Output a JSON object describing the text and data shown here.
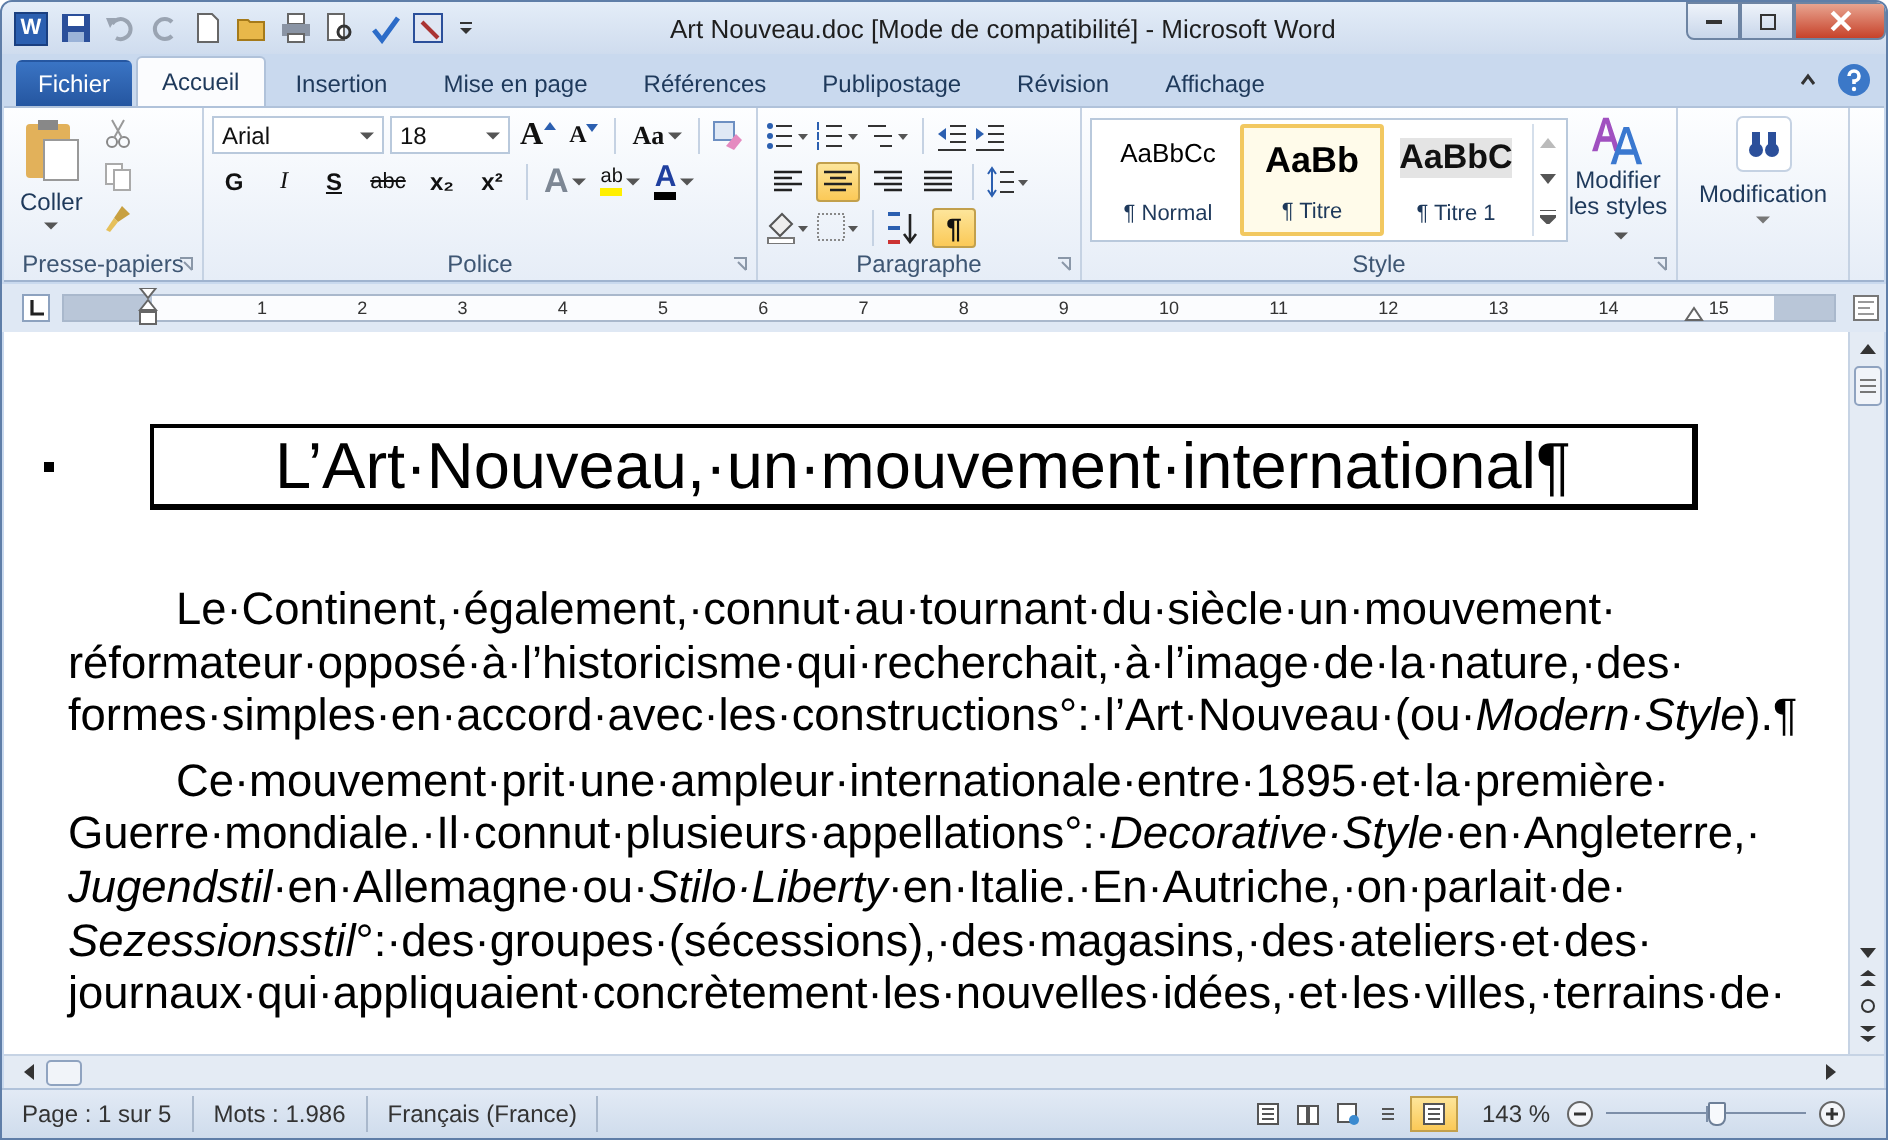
{
  "window": {
    "title": "Art Nouveau.doc [Mode de compatibilité]  -  Microsoft Word",
    "app_logo": "W"
  },
  "tabs": [
    {
      "label": "Fichier",
      "kind": "file",
      "selected": false
    },
    {
      "label": "Accueil",
      "kind": "tab",
      "selected": true
    },
    {
      "label": "Insertion",
      "kind": "tab",
      "selected": false
    },
    {
      "label": "Mise en page",
      "kind": "tab",
      "selected": false
    },
    {
      "label": "Références",
      "kind": "tab",
      "selected": false
    },
    {
      "label": "Publipostage",
      "kind": "tab",
      "selected": false
    },
    {
      "label": "Révision",
      "kind": "tab",
      "selected": false
    },
    {
      "label": "Affichage",
      "kind": "tab",
      "selected": false
    }
  ],
  "clipboard": {
    "paste_label": "Coller",
    "group_label": "Presse-papiers"
  },
  "font": {
    "name": "Arial",
    "size": "18",
    "grow": "A",
    "shrink": "A",
    "change_case": "Aa",
    "group_label": "Police",
    "format_buttons": [
      {
        "kind": "bold",
        "label": "G"
      },
      {
        "kind": "italic",
        "label": "I"
      },
      {
        "kind": "underline",
        "label": "S"
      },
      {
        "kind": "strike",
        "label": "abc"
      },
      {
        "kind": "sub",
        "label": "x₂"
      },
      {
        "kind": "sup",
        "label": "x²"
      }
    ],
    "effects": "A",
    "highlight": "ab",
    "font_color_label": "A"
  },
  "paragraph": {
    "group_label": "Paragraphe",
    "show_marks": {
      "label": "¶",
      "selected": true
    },
    "align_buttons": [
      {
        "kind": "left",
        "selected": false
      },
      {
        "kind": "center",
        "selected": true
      },
      {
        "kind": "right",
        "selected": false
      },
      {
        "kind": "justify",
        "selected": false
      }
    ]
  },
  "styles": {
    "group_label": "Style",
    "modify_label": "Modifier les styles",
    "items": [
      {
        "preview": "AaBbCc",
        "name": "¶ Normal",
        "kind": "normal",
        "selected": false
      },
      {
        "preview": "AaBb",
        "name": "¶ Titre",
        "kind": "title",
        "selected": true
      },
      {
        "preview": "AaBbC",
        "name": "¶ Titre 1",
        "kind": "heading",
        "selected": false
      }
    ]
  },
  "editing": {
    "label": "Modification"
  },
  "ruler": {
    "numbers": [
      "1",
      "2",
      "3",
      "4",
      "5",
      "6",
      "7",
      "8",
      "9",
      "10",
      "11",
      "12",
      "13",
      "14",
      "15"
    ]
  },
  "document": {
    "title": "L’Art·Nouveau,·un·mouvement·international¶",
    "paragraphs": [
      {
        "lines": [
          "Le·Continent,·également,·connut·au·tournant·du·siècle·un·mouvement·",
          "réformateur·opposé·à·l’historicisme·qui·recherchait,·à·l’image·de·la·nature,·des·",
          "formes·simples·en·accord·avec·les·constructions°:·l’Art·Nouveau·(ou·*Modern·Style*).¶"
        ]
      },
      {
        "lines": [
          "Ce·mouvement·prit·une·ampleur·internationale·entre·1895·et·la·première·",
          "Guerre·mondiale.·Il·connut·plusieurs·appellations°:·*Decorative·Style*·en·Angleterre,·",
          "*Jugendstil*·en·Allemagne·ou·*Stilo·Liberty*·en·Italie.·En·Autriche,·on·parlait·de·",
          "*Sezessionsstil*°:·des·groupes·(sécessions),·des·magasins,·des·ateliers·et·des·",
          "journaux·qui·appliquaient·concrètement·les·nouvelles·idées,·et·les·villes,·terrains·de·"
        ]
      }
    ]
  },
  "status_bar": {
    "page": "Page : 1 sur 5",
    "words": "Mots : 1.986",
    "language": "Français (France)",
    "zoom": "143 %",
    "zoom_level": {
      "level": 0.55
    },
    "views": [
      {
        "kind": "print",
        "selected": false
      },
      {
        "kind": "read",
        "selected": false
      },
      {
        "kind": "web",
        "selected": false
      },
      {
        "kind": "outline",
        "selected": false
      },
      {
        "kind": "draft",
        "selected": true
      }
    ]
  }
}
